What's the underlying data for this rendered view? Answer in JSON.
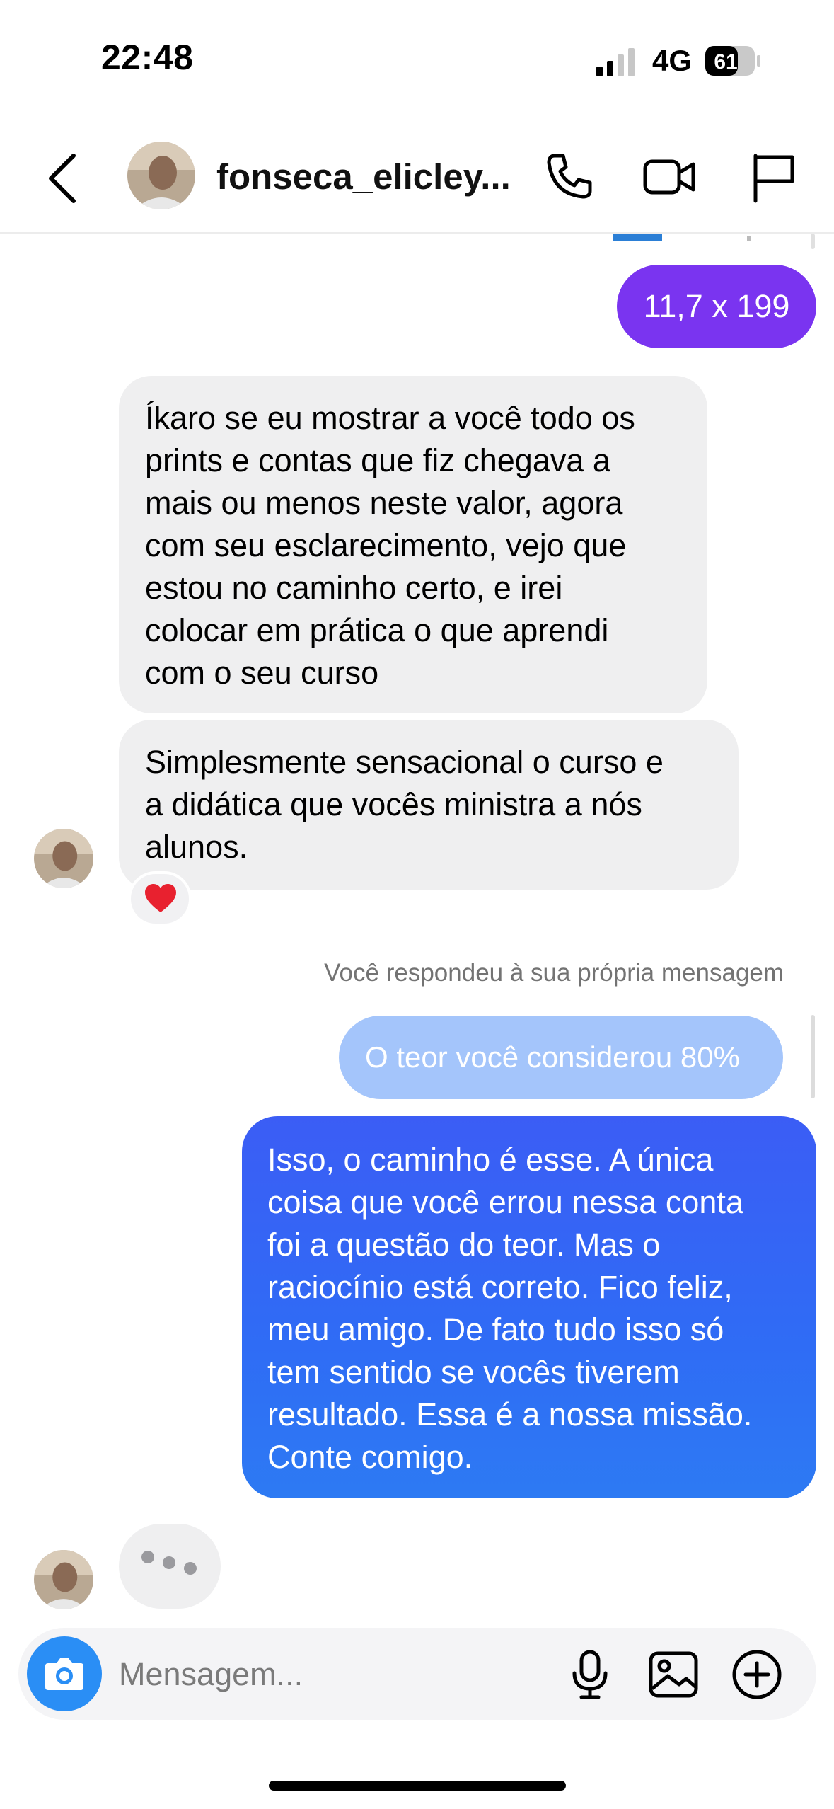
{
  "status_bar": {
    "time": "22:48",
    "network": "4G",
    "battery": "61"
  },
  "header": {
    "back_icon": "chevron-left-icon",
    "username": "fonseca_elicley...",
    "icons": [
      "phone-icon",
      "video-camera-icon",
      "flag-icon"
    ]
  },
  "messages": [
    {
      "from": "me",
      "text": "11,7 x 199",
      "color": "#7a34f0"
    },
    {
      "from": "them",
      "lines": [
        "Íkaro se eu mostrar a você todo os",
        "prints e contas que fiz chegava a",
        "mais ou menos neste valor, agora",
        "com seu esclarecimento, vejo que",
        "estou no caminho certo, e irei",
        "colocar em prática o que aprendi",
        "com o seu curso"
      ]
    },
    {
      "from": "them",
      "lines": [
        "Simplesmente sensacional o curso e",
        "a didática que vocês ministra a nós",
        "alunos."
      ],
      "reaction": "red-heart-icon"
    },
    {
      "type": "reply_note",
      "text": "Você respondeu à sua própria mensagem"
    },
    {
      "from": "me",
      "quoted": true,
      "text": "O teor você considerou 80%"
    },
    {
      "from": "me",
      "lines": [
        "Isso, o caminho é esse. A única",
        "coisa que você errou nessa conta",
        "foi a questão do teor. Mas o",
        "raciocínio está correto. Fico feliz,",
        "meu amigo. De fato tudo isso só",
        "tem sentido se vocês tiverem",
        "resultado. Essa é a nossa missão.",
        "Conte comigo."
      ],
      "color": "#2f6cf5"
    },
    {
      "from": "them",
      "type": "typing_indicator"
    }
  ],
  "composer": {
    "placeholder": "Mensagem...",
    "icons": [
      "camera-icon",
      "microphone-icon",
      "image-icon",
      "plus-circle-icon"
    ]
  },
  "colors": {
    "purple_bubble": "#7a34f0",
    "blue_bubble": "#2f6cf5",
    "gray_bubble": "#efeff0",
    "camera_button": "#2a8ef5"
  }
}
